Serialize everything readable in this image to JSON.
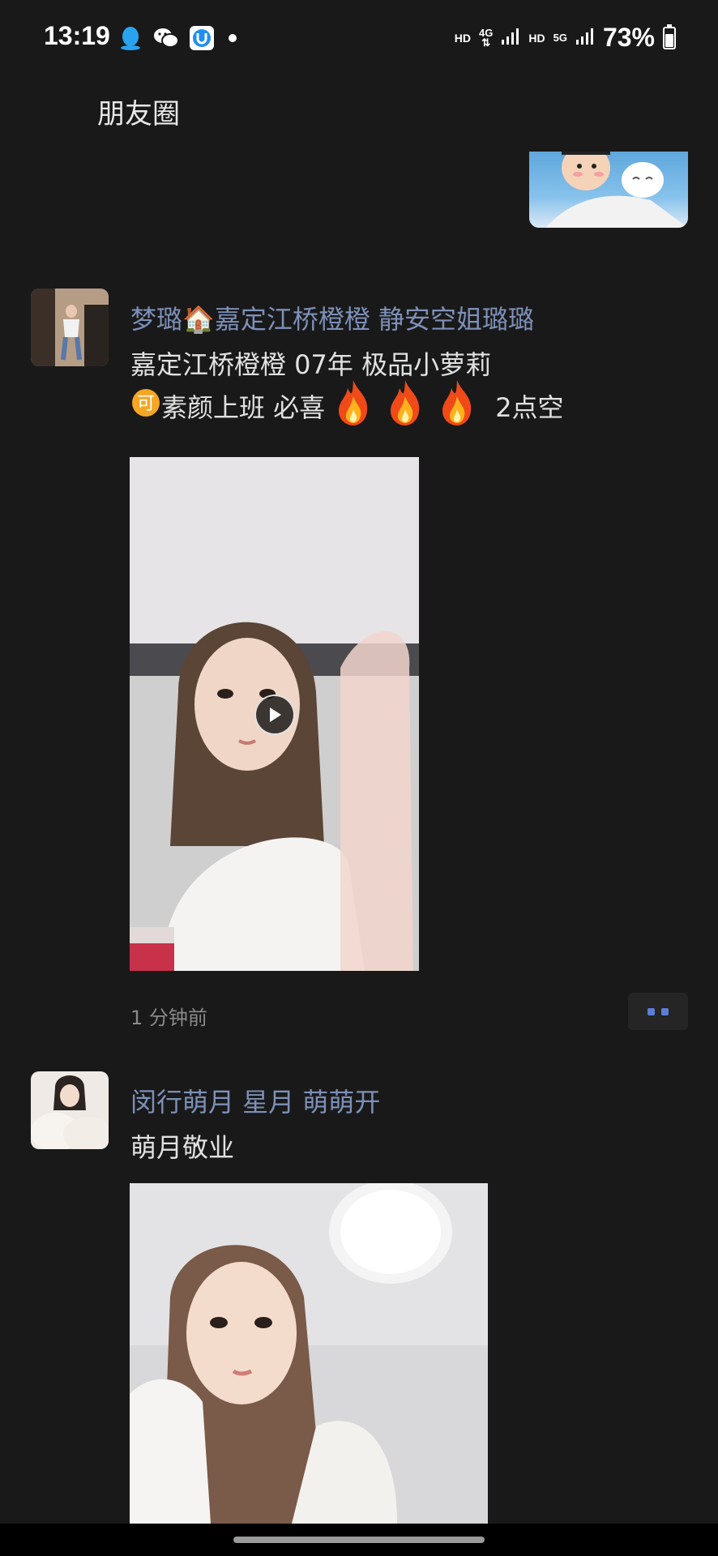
{
  "status_bar": {
    "time": "13:19",
    "hd1": "HD",
    "net1": "4G",
    "hd2": "HD",
    "net2": "5G",
    "battery": "73%",
    "battery_level": 0.73
  },
  "nav": {
    "title": "朋友圈"
  },
  "posts": [
    {
      "name": "梦璐🏠嘉定江桥橙橙   静安空姐璐璐",
      "line1": "嘉定江桥橙橙  07年  极品小萝莉",
      "line2_prefix": "素颜上班  必喜",
      "line2_suffix": "2点空",
      "timestamp": "1 分钟前"
    },
    {
      "name": "闵行萌月  星月  萌萌开",
      "line1": "萌月敬业"
    }
  ],
  "colors": {
    "background": "#191919",
    "name_link": "#7d90b8",
    "more_dots": "#5b7fd6"
  }
}
